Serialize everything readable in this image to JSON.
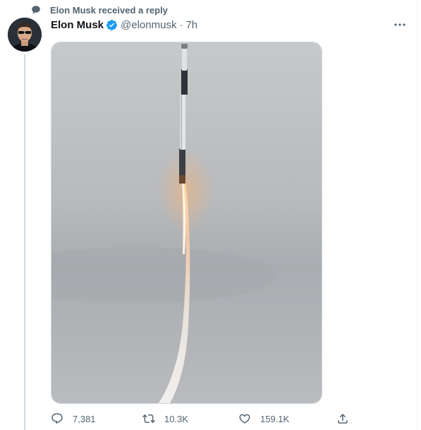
{
  "context": {
    "icon": "speech-bubble-icon",
    "text": "Elon Musk received a reply"
  },
  "tweet": {
    "author_name": "Elon Musk",
    "verified": true,
    "handle": "@elonmusk",
    "separator": "·",
    "time": "7h",
    "media": {
      "type": "photo"
    }
  },
  "actions": {
    "reply_count": "7,381",
    "retweet_count": "10.3K",
    "like_count": "159.1K"
  },
  "colors": {
    "accent": "#1d9bf0",
    "secondary_text": "#536471",
    "primary_text": "#0f1419",
    "border": "#cfd9de"
  }
}
